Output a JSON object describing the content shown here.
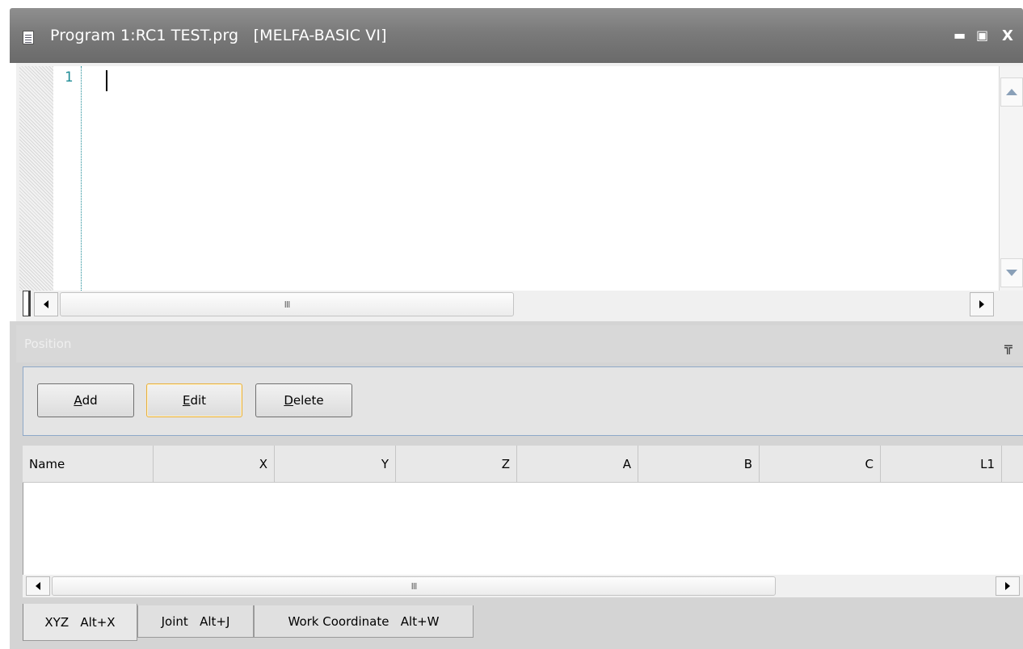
{
  "window": {
    "title": "Program 1:RC1 TEST.prg   [MELFA-BASIC VI]",
    "controls": {
      "minimize": "▬",
      "maximize": "▣",
      "close": "X"
    }
  },
  "editor": {
    "line_numbers": [
      "1"
    ],
    "scroll_thumb_grip": "III"
  },
  "panel": {
    "title": "Position",
    "buttons": {
      "add": {
        "accel": "A",
        "rest": "dd"
      },
      "edit": {
        "accel": "E",
        "rest": "dit"
      },
      "delete": {
        "accel": "D",
        "rest": "elete"
      }
    },
    "columns": [
      "Name",
      "X",
      "Y",
      "Z",
      "A",
      "B",
      "C",
      "L1"
    ],
    "scroll_thumb_grip": "III",
    "tabs": [
      "XYZ   Alt+X",
      "Joint   Alt+J",
      "Work Coordinate   Alt+W"
    ]
  }
}
